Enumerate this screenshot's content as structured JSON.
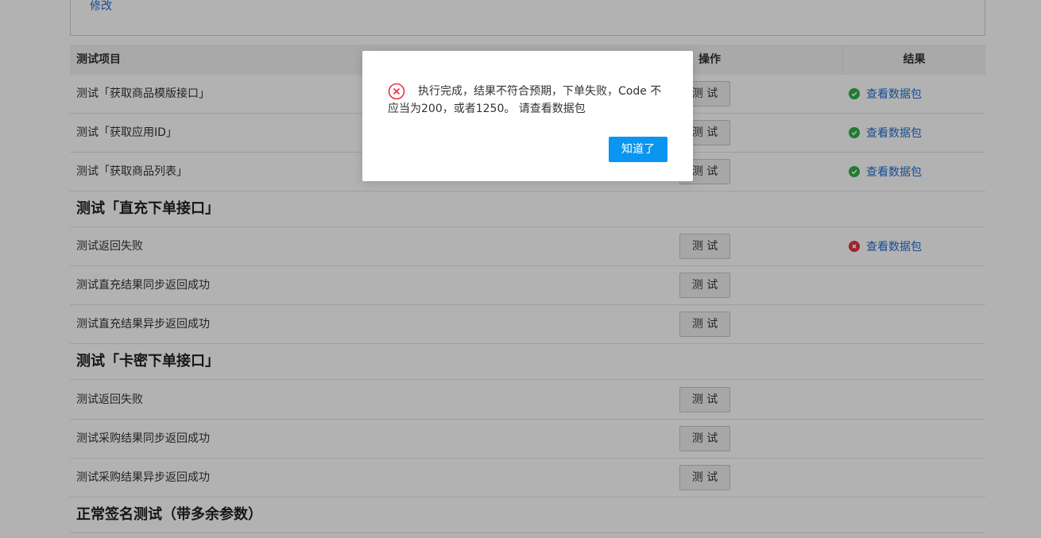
{
  "top": {
    "edit_link": "修改"
  },
  "table": {
    "headers": {
      "item": "测试项目",
      "action": "操作",
      "result": "结果"
    },
    "test_button_label": "测 试",
    "result_link_label": "查看数据包"
  },
  "rows_group1": [
    {
      "label": "测试「获取商品模版接口」",
      "status": "success"
    },
    {
      "label": "测试「获取应用ID」",
      "status": "success"
    },
    {
      "label": "测试「获取商品列表」",
      "status": "success"
    }
  ],
  "section_direct": {
    "title": "测试「直充下单接口」"
  },
  "rows_direct": [
    {
      "label": "测试返回失败",
      "status": "error"
    },
    {
      "label": "测试直充结果同步返回成功",
      "status": "none"
    },
    {
      "label": "测试直充结果异步返回成功",
      "status": "none"
    }
  ],
  "section_card": {
    "title": "测试「卡密下单接口」"
  },
  "rows_card": [
    {
      "label": "测试返回失败",
      "status": "none"
    },
    {
      "label": "测试采购结果同步返回成功",
      "status": "none"
    },
    {
      "label": "测试采购结果异步返回成功",
      "status": "none"
    }
  ],
  "section_sign": {
    "title": "正常签名测试（带多余参数）"
  },
  "dialog": {
    "icon": "error-circle-icon",
    "message": "执行完成，结果不符合预期，下单失败，Code 不应当为200，或者1250。 请查看数据包",
    "ok_label": "知道了"
  },
  "colors": {
    "link": "#1f6fd0",
    "success": "#2db14a",
    "error": "#e3343f",
    "primary_button": "#0a96f0"
  }
}
